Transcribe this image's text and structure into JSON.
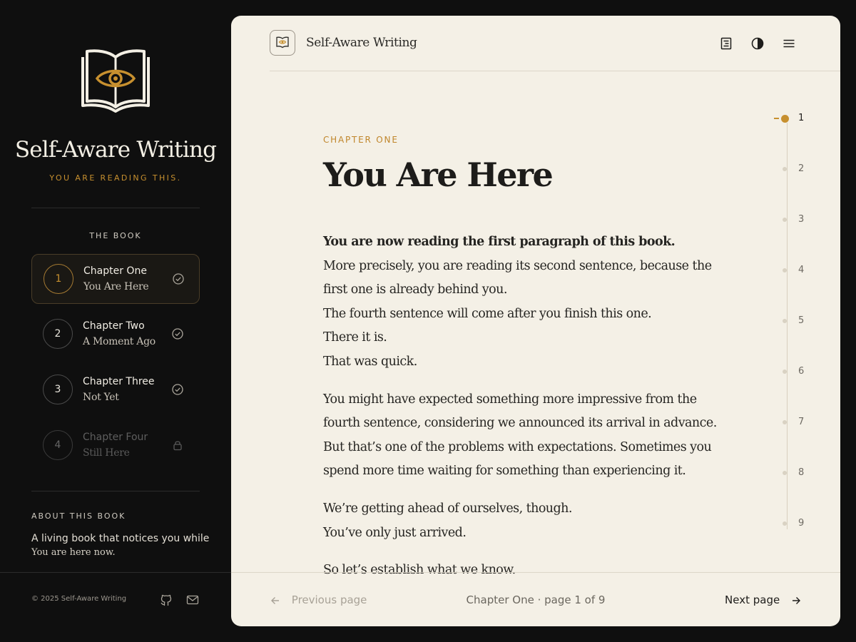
{
  "sidebar": {
    "brand_title": "Self-Aware Writing",
    "brand_tagline": "YOU ARE READING THIS.",
    "section_label": "THE BOOK",
    "chapters": [
      {
        "number": "1",
        "title": "Chapter One",
        "subtitle": "You Are Here",
        "status": "done",
        "status_icon": "check-circle-icon",
        "active": true
      },
      {
        "number": "2",
        "title": "Chapter Two",
        "subtitle": "A Moment Ago",
        "status": "done",
        "status_icon": "check-circle-icon",
        "active": false
      },
      {
        "number": "3",
        "title": "Chapter Three",
        "subtitle": "Not Yet",
        "status": "done",
        "status_icon": "check-circle-icon",
        "active": false
      },
      {
        "number": "4",
        "title": "Chapter Four",
        "subtitle": "Still Here",
        "status": "locked",
        "status_icon": "lock-icon",
        "active": false
      }
    ],
    "about_label": "ABOUT THIS BOOK",
    "about_text": "A living book that notices you while",
    "about_sub": "You are here now.",
    "copyright": "© 2025 Self-Aware Writing"
  },
  "header": {
    "title": "Self-Aware Writing"
  },
  "content": {
    "chapter_label": "CHAPTER ONE",
    "chapter_title": "You Are Here",
    "paragraphs": [
      [
        "You are now reading the first paragraph of this book.",
        "More precisely, you are reading its second sentence, because the",
        "first one is already behind you.",
        "The fourth sentence will come after you finish this one.",
        "There it is.",
        "That was quick."
      ],
      [
        "You might have expected something more impressive from the",
        "fourth sentence, considering we announced its arrival in advance.",
        "But that’s one of the problems with expectations. Sometimes you",
        "spend more time waiting for something than experiencing it."
      ],
      [
        "We’re getting ahead of ourselves, though.",
        "You’ve only just arrived."
      ],
      [
        "So let’s establish what we know."
      ]
    ]
  },
  "page_rail": {
    "pages": [
      "1",
      "2",
      "3",
      "4",
      "5",
      "6",
      "7",
      "8",
      "9"
    ],
    "current": 1
  },
  "footer": {
    "prev_label": "Previous page",
    "page_info": "Chapter One  ·  page 1 of 9",
    "next_label": "Next page"
  },
  "colors": {
    "accent": "#c7902f",
    "background_dark": "#0f0f0f",
    "paper": "#f4f0e6"
  }
}
